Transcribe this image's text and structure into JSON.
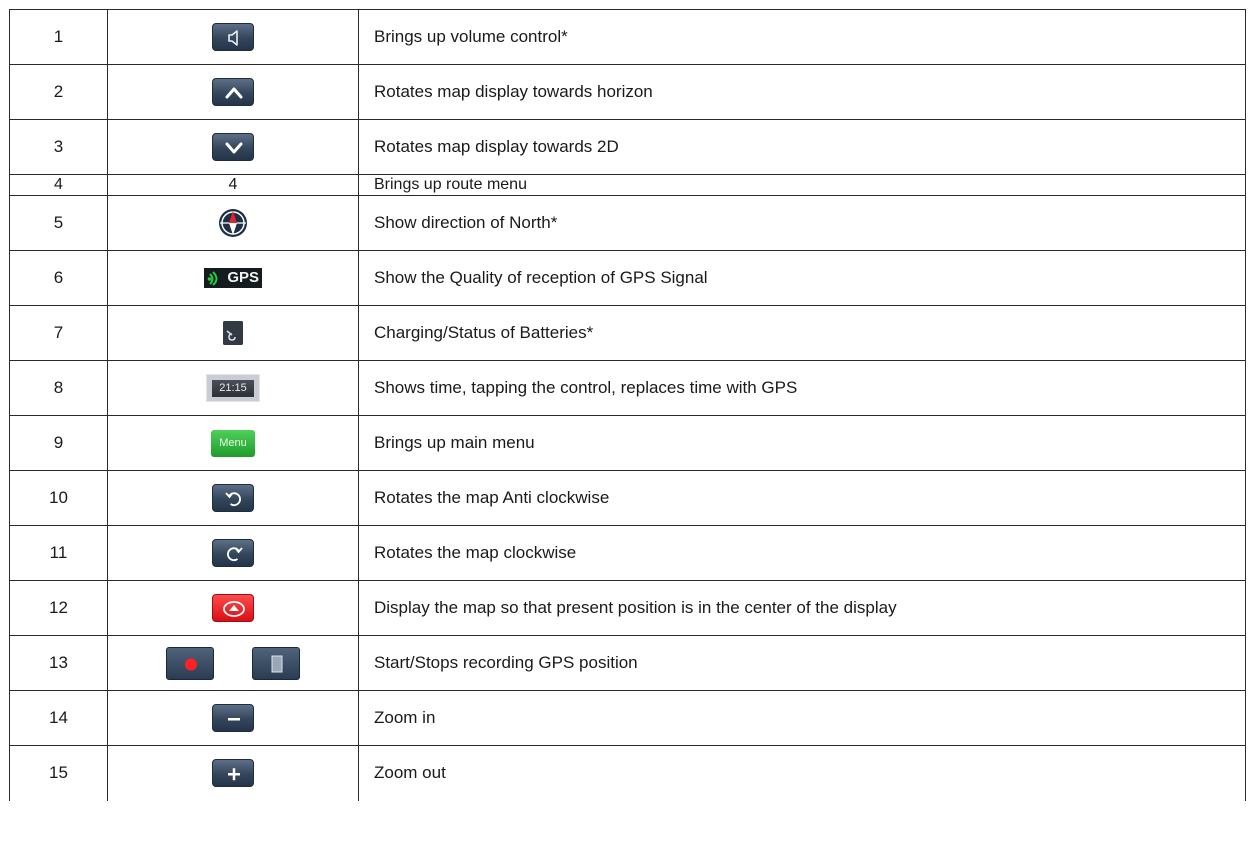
{
  "rows": [
    {
      "num": "1",
      "desc": "Brings up volume control*",
      "icon": "speaker-icon"
    },
    {
      "num": "2",
      "desc": "Rotates map display towards horizon",
      "icon": "chevron-up-icon"
    },
    {
      "num": "3",
      "desc": "Rotates map display towards 2D",
      "icon": "chevron-down-icon"
    },
    {
      "num": "4",
      "icon_text": "4",
      "desc": "Brings up route menu"
    },
    {
      "num": "5",
      "desc": "Show direction of North*",
      "icon": "compass-icon"
    },
    {
      "num": "6",
      "desc": "Show the Quality of reception of GPS Signal",
      "icon": "gps-signal-icon",
      "icon_text": "GPS"
    },
    {
      "num": "7",
      "desc": "Charging/Status of Batteries*",
      "icon": "battery-icon"
    },
    {
      "num": "8",
      "desc": "Shows time, tapping the control, replaces time with GPS",
      "icon": "clock-icon",
      "icon_text": "21:15"
    },
    {
      "num": "9",
      "desc": "Brings up main menu",
      "icon": "menu-button-icon",
      "icon_text": "Menu"
    },
    {
      "num": "10",
      "desc": "Rotates the map Anti clockwise",
      "icon": "rotate-anticlockwise-icon"
    },
    {
      "num": "11",
      "desc": "Rotates the map clockwise",
      "icon": "rotate-clockwise-icon"
    },
    {
      "num": "12",
      "desc": "Display the map so that present position is in the center of the display",
      "icon": "center-position-icon"
    },
    {
      "num": "13",
      "desc": "Start/Stops recording GPS position",
      "icon": "record-icon",
      "icon2": "stop-icon"
    },
    {
      "num": "14",
      "desc": "Zoom in",
      "icon": "minus-icon"
    },
    {
      "num": "15",
      "desc": "Zoom out",
      "icon": "plus-icon"
    }
  ],
  "colors": {
    "button_dark": "#34465c",
    "button_red": "#e21a1f",
    "button_green": "#2fb43a",
    "record_dot": "#ff2020",
    "gps_signal": "#27c93f"
  }
}
